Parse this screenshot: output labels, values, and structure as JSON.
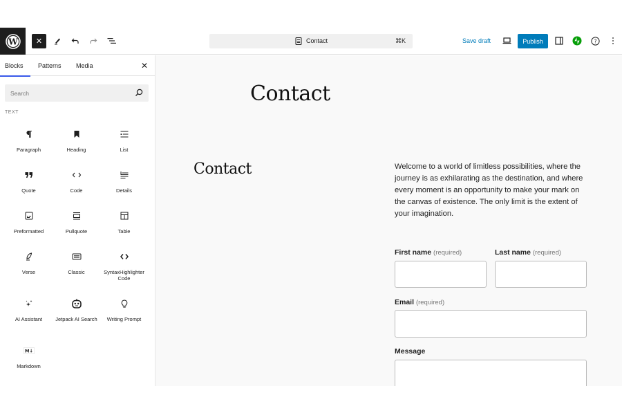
{
  "topbar": {
    "logo": "wordpress-logo",
    "toggle_close_label": "✕",
    "command": {
      "title": "Contact",
      "shortcut": "⌘K"
    },
    "save_draft_label": "Save draft",
    "publish_label": "Publish"
  },
  "sidebar": {
    "tabs": [
      {
        "label": "Blocks",
        "active": true
      },
      {
        "label": "Patterns",
        "active": false
      },
      {
        "label": "Media",
        "active": false
      }
    ],
    "search_placeholder": "Search",
    "section_label": "TEXT",
    "blocks": [
      {
        "label": "Paragraph",
        "icon": "paragraph-icon"
      },
      {
        "label": "Heading",
        "icon": "heading-icon"
      },
      {
        "label": "List",
        "icon": "list-icon"
      },
      {
        "label": "Quote",
        "icon": "quote-icon"
      },
      {
        "label": "Code",
        "icon": "code-icon"
      },
      {
        "label": "Details",
        "icon": "details-icon"
      },
      {
        "label": "Preformatted",
        "icon": "preformatted-icon"
      },
      {
        "label": "Pullquote",
        "icon": "pullquote-icon"
      },
      {
        "label": "Table",
        "icon": "table-icon"
      },
      {
        "label": "Verse",
        "icon": "verse-icon"
      },
      {
        "label": "Classic",
        "icon": "classic-icon"
      },
      {
        "label": "SyntaxHighlighter Code",
        "icon": "syntax-code-icon"
      },
      {
        "label": "AI Assistant",
        "icon": "ai-sparkle-icon"
      },
      {
        "label": "Jetpack AI Search",
        "icon": "robot-icon"
      },
      {
        "label": "Writing Prompt",
        "icon": "lightbulb-icon"
      },
      {
        "label": "Markdown",
        "icon": "markdown-icon"
      }
    ]
  },
  "canvas": {
    "page_title": "Contact",
    "heading": "Contact",
    "intro": "Welcome to a world of limitless possibilities, where the journey is as exhilarating as the destination, and where every moment is an opportunity to make your mark on the canvas of existence. The only limit is the extent of your imagination.",
    "form": {
      "first_name_label": "First name",
      "last_name_label": "Last name",
      "email_label": "Email",
      "message_label": "Message",
      "required_text": "(required)",
      "first_name_value": "",
      "last_name_value": "",
      "email_value": "",
      "message_value": ""
    }
  },
  "colors": {
    "accent": "#007cba",
    "tab_indicator": "#3858e9",
    "jetpack_green": "#069e08",
    "dark": "#1e1e1e",
    "canvas_bg": "#f9f9f9"
  }
}
